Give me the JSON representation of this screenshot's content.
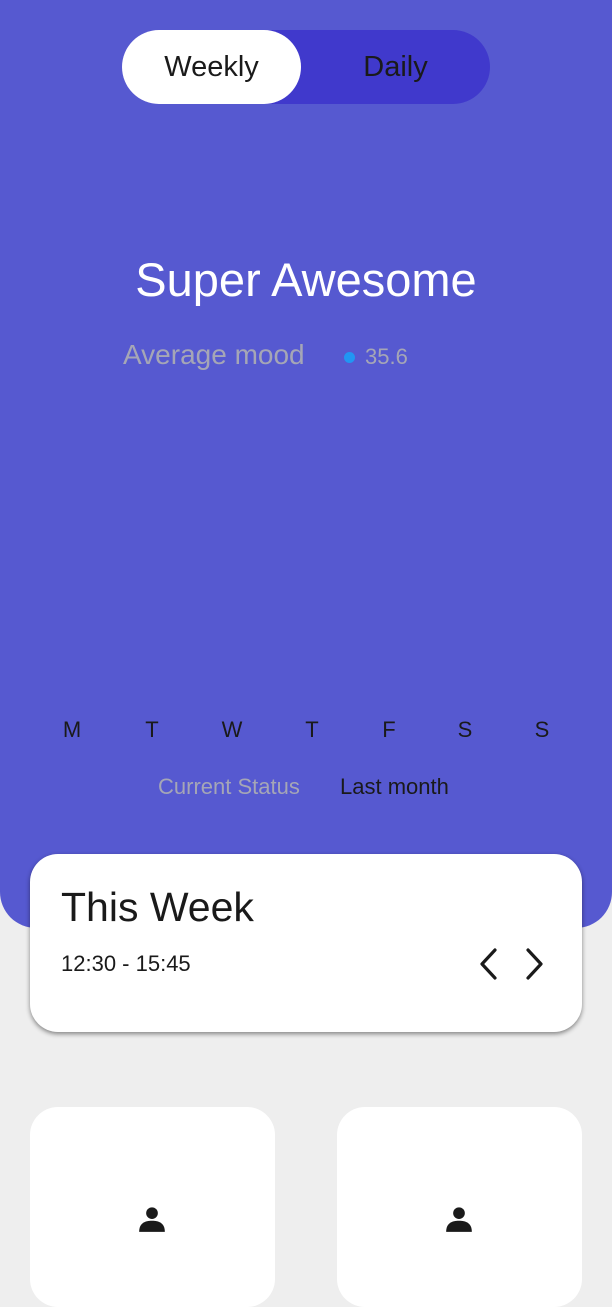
{
  "toggle": {
    "weekly_label": "Weekly",
    "daily_label": "Daily",
    "selected": "Weekly"
  },
  "mood": {
    "title": "Super Awesome",
    "average_label": "Average mood",
    "average_value": "35.6"
  },
  "days": [
    "M",
    "T",
    "W",
    "T",
    "F",
    "S",
    "S"
  ],
  "status": {
    "current_label": "Current Status",
    "last_label": "Last month"
  },
  "week_card": {
    "title": "This Week",
    "time_range": "12:30 - 15:45",
    "prev_icon": "chevron-left-icon",
    "next_icon": "chevron-right-icon"
  },
  "bottom_cards": [
    {
      "icon": "person-icon"
    },
    {
      "icon": "person-icon"
    }
  ],
  "colors": {
    "hero_background": "#5659d0",
    "toggle_track": "#4039cc",
    "toggle_selected": "#ffffff",
    "average_dot": "#2196f3",
    "muted_text": "#a5a6b6",
    "page_background": "#eeeeee"
  }
}
